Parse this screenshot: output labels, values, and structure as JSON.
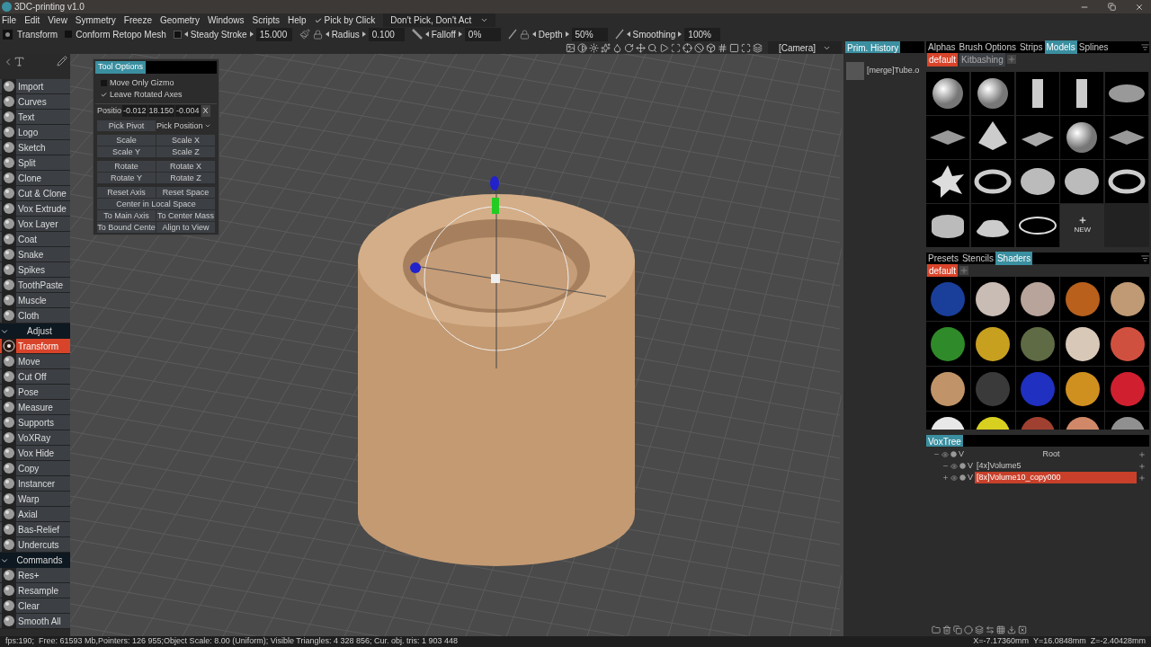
{
  "window": {
    "title": "3DC-printing v1.0"
  },
  "menu": [
    "File",
    "Edit",
    "View",
    "Symmetry",
    "Freeze",
    "Geometry",
    "Windows",
    "Scripts",
    "Help"
  ],
  "pick_by_click": {
    "label": "Pick by Click",
    "checked": true
  },
  "pick_mode": {
    "value": "Don't Pick, Don't Act"
  },
  "toolbar": {
    "tool": "Transform",
    "conform": {
      "label": "Conform Retopo Mesh",
      "checked": false
    },
    "params": [
      {
        "kind": "steady",
        "label": "Steady Stroke",
        "value": "15.000",
        "checked": false
      },
      {
        "kind": "radius",
        "label": "Radius",
        "value": "0.100"
      },
      {
        "kind": "falloff",
        "label": "Falloff",
        "value": "0%"
      },
      {
        "kind": "depth",
        "label": "Depth",
        "value": "50%"
      },
      {
        "kind": "smoothing",
        "label": "Smoothing",
        "value": "100%"
      }
    ]
  },
  "camera": {
    "value": "[Camera]"
  },
  "tool_panel": [
    {
      "kind": "tool",
      "label": "Import",
      "selected": false
    },
    {
      "kind": "tool",
      "label": "Curves",
      "selected": false
    },
    {
      "kind": "tool",
      "label": "Text",
      "selected": false
    },
    {
      "kind": "tool",
      "label": "Logo",
      "selected": false
    },
    {
      "kind": "tool",
      "label": "Sketch",
      "selected": false
    },
    {
      "kind": "tool",
      "label": "Split",
      "selected": false
    },
    {
      "kind": "tool",
      "label": "Clone",
      "selected": false
    },
    {
      "kind": "tool",
      "label": "Cut & Clone",
      "selected": false
    },
    {
      "kind": "tool",
      "label": "Vox Extrude",
      "selected": false
    },
    {
      "kind": "tool",
      "label": "Vox Layer",
      "selected": false
    },
    {
      "kind": "tool",
      "label": "Coat",
      "selected": false
    },
    {
      "kind": "tool",
      "label": "Snake",
      "selected": false
    },
    {
      "kind": "tool",
      "label": "Spikes",
      "selected": false
    },
    {
      "kind": "tool",
      "label": "ToothPaste",
      "selected": false
    },
    {
      "kind": "tool",
      "label": "Muscle",
      "selected": false
    },
    {
      "kind": "tool",
      "label": "Cloth",
      "selected": false
    },
    {
      "kind": "section",
      "label": "Adjust",
      "expanded": true
    },
    {
      "kind": "tool",
      "label": "Transform",
      "selected": true
    },
    {
      "kind": "tool",
      "label": "Move",
      "selected": false
    },
    {
      "kind": "tool",
      "label": "Cut Off",
      "selected": false
    },
    {
      "kind": "tool",
      "label": "Pose",
      "selected": false
    },
    {
      "kind": "tool",
      "label": "Measure",
      "selected": false
    },
    {
      "kind": "tool",
      "label": "Supports",
      "selected": false
    },
    {
      "kind": "tool",
      "label": "VoXRay",
      "selected": false
    },
    {
      "kind": "tool",
      "label": "Vox Hide",
      "selected": false
    },
    {
      "kind": "tool",
      "label": "Copy",
      "selected": false
    },
    {
      "kind": "tool",
      "label": "Instancer",
      "selected": false
    },
    {
      "kind": "tool",
      "label": "Warp",
      "selected": false
    },
    {
      "kind": "tool",
      "label": "Axial",
      "selected": false
    },
    {
      "kind": "tool",
      "label": "Bas-Relief",
      "selected": false
    },
    {
      "kind": "tool",
      "label": "Undercuts",
      "selected": false
    },
    {
      "kind": "section",
      "label": "Commands",
      "expanded": true
    },
    {
      "kind": "tool",
      "label": "Res+",
      "selected": false
    },
    {
      "kind": "tool",
      "label": "Resample",
      "selected": false
    },
    {
      "kind": "tool",
      "label": "Clear",
      "selected": false
    },
    {
      "kind": "tool",
      "label": "Smooth All",
      "selected": false
    }
  ],
  "tool_options": {
    "title": "Tool Options",
    "checkboxes": [
      {
        "label": "Move Only Gizmo",
        "checked": false
      },
      {
        "label": "Leave Rotated Axes",
        "checked": true
      }
    ],
    "position": {
      "label": "Positio",
      "values": [
        "-0.012",
        "18.150",
        "-0.004"
      ],
      "clear": "X"
    },
    "pick_pivot": "Pick Pivot",
    "pick_position": "Pick Position",
    "button_groups": [
      [
        [
          "Scale",
          "Scale X"
        ],
        [
          "Scale Y",
          "Scale Z"
        ]
      ],
      [
        [
          "Rotate",
          "Rotate X"
        ],
        [
          "Rotate Y",
          "Rotate Z"
        ]
      ],
      [
        [
          "Reset Axis",
          "Reset Space"
        ],
        [
          "Center in Local Space"
        ],
        [
          "To Main Axis",
          "To Center Mass"
        ],
        [
          "To Bound Cente",
          "Align to View"
        ]
      ]
    ]
  },
  "prim_history": {
    "tab": "Prim. History",
    "items": [
      "[merge]Tube.o"
    ]
  },
  "models_panel": {
    "tabs": [
      {
        "label": "Alphas",
        "selected": false
      },
      {
        "label": "Brush Options",
        "selected": false
      },
      {
        "label": "Strips",
        "selected": false
      },
      {
        "label": "Models",
        "selected": true
      },
      {
        "label": "Splines",
        "selected": false
      }
    ],
    "categories": [
      {
        "label": "default",
        "selected": true
      },
      {
        "label": "Kitbashing",
        "selected": false
      }
    ],
    "new_label": "NEW"
  },
  "shaders_panel": {
    "tabs": [
      {
        "label": "Presets",
        "selected": false
      },
      {
        "label": "Stencils",
        "selected": false
      },
      {
        "label": "Shaders",
        "selected": true
      }
    ],
    "categories": [
      {
        "label": "default",
        "selected": true
      }
    ],
    "shaders": [
      {
        "color": "#1a3f9a"
      },
      {
        "color": "#c8bcb4"
      },
      {
        "color": "#b8a49a"
      },
      {
        "color": "#b8601c"
      },
      {
        "color": "#c09a74"
      },
      {
        "color": "#2f8a2a"
      },
      {
        "color": "#c8a020"
      },
      {
        "color": "#5e6b44"
      },
      {
        "color": "#d8c8b8"
      },
      {
        "color": "#d05040"
      },
      {
        "color": "#c09468"
      },
      {
        "color": "#3a3a3a"
      },
      {
        "color": "#2030c0"
      },
      {
        "color": "#d09020"
      },
      {
        "color": "#d02030"
      },
      {
        "color": "#e8e8e8"
      },
      {
        "color": "#d8d020"
      },
      {
        "color": "#a04030"
      },
      {
        "color": "#d08868"
      },
      {
        "color": "#909090"
      }
    ]
  },
  "voxtree": {
    "tab": "VoxTree",
    "root": {
      "label": "Root",
      "flag": "V",
      "expanded": true,
      "selected": false,
      "children": [
        {
          "label": "[4x]Volume5",
          "flag": "V",
          "expanded": true,
          "selected": false
        },
        {
          "label": "[8x]Volume10_copy000",
          "flag": "V",
          "expanded": false,
          "selected": true
        }
      ]
    }
  },
  "status_bar": {
    "left": "fps:190;  Free: 61593 Mb,Pointers: 126 955;Object Scale: 8.00 (Uniform); Visible Triangles: 4 328 856; Cur. obj. tris: 1 903 448",
    "right": "X=-7.17360mm  Y=16.0848mm  Z=-2.40428mm"
  }
}
